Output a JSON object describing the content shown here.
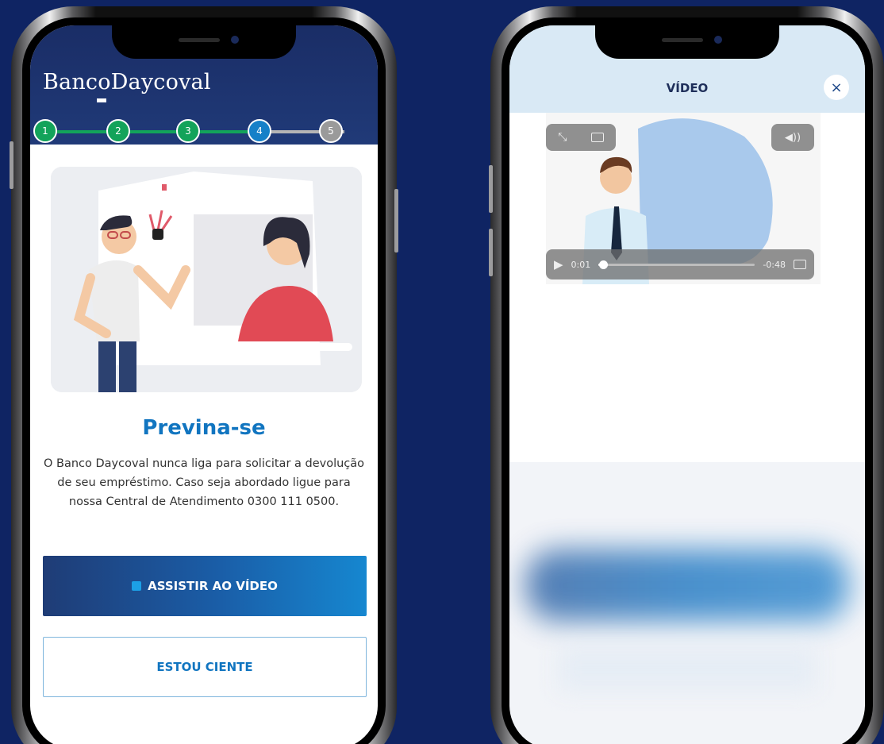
{
  "left_screen": {
    "logo_text": "BancoDaycoval",
    "steps": [
      "1",
      "2",
      "3",
      "4",
      "5"
    ],
    "current_step": 4,
    "heading": "Previna-se",
    "description": "O Banco Daycoval nunca liga para solicitar a devolução de seu empréstimo. Caso seja abordado ligue para nossa Central de Atendimento 0300 111 0500.",
    "watch_button_label": "ASSISTIR AO VÍDEO",
    "acknowledge_button_label": "ESTOU CIENTE"
  },
  "right_screen": {
    "title": "VÍDEO",
    "close_label": "×",
    "player": {
      "elapsed": "0:01",
      "remaining": "-0:48",
      "progress": 0.03
    }
  },
  "colors": {
    "background": "#0f2463",
    "header": "#1a2d66",
    "accent": "#1175c0",
    "step_done": "#13a35a",
    "step_current": "#1680c8",
    "step_pending": "#9a9a9a"
  },
  "icons": [
    "play-icon",
    "fullscreen-icon",
    "pip-icon",
    "volume-icon",
    "airplay-icon",
    "close-icon"
  ]
}
